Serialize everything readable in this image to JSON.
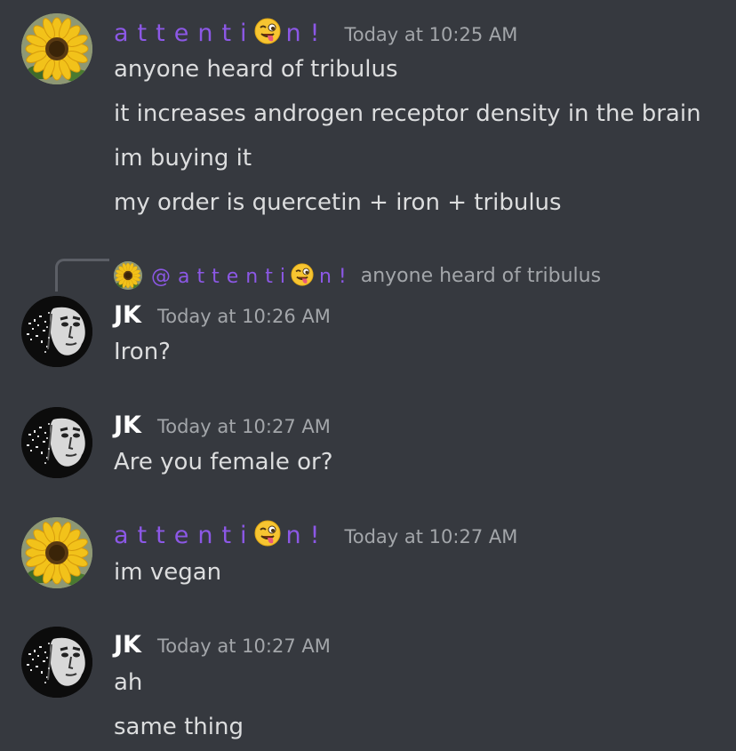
{
  "channel": {
    "messages": [
      {
        "author": "attention!",
        "author_display": {
          "before": "attenti",
          "after": "n!"
        },
        "emoji": "winking-tongue-emoji",
        "timestamp": "Today at 10:25 AM",
        "lines": [
          "anyone heard of tribulus",
          "it increases androgen receptor density in the brain",
          "im buying it",
          "my order is quercetin + iron + tribulus"
        ]
      },
      {
        "reply_to": {
          "mention_prefix": "@",
          "author_display": {
            "before": "attenti",
            "after": "n!"
          },
          "text": "anyone heard of tribulus"
        },
        "author": "JK",
        "timestamp": "Today at 10:26 AM",
        "lines": [
          "Iron?"
        ]
      },
      {
        "author": "JK",
        "timestamp": "Today at 10:27 AM",
        "lines": [
          "Are you female or?"
        ]
      },
      {
        "author": "attention!",
        "author_display": {
          "before": "attenti",
          "after": "n!"
        },
        "emoji": "winking-tongue-emoji",
        "timestamp": "Today at 10:27 AM",
        "lines": [
          "im vegan"
        ]
      },
      {
        "author": "JK",
        "timestamp": "Today at 10:27 AM",
        "lines": [
          "ah",
          "same thing"
        ]
      }
    ]
  },
  "colors": {
    "background": "#36393f",
    "username_purple": "#8c58e6",
    "text": "#dcddde",
    "muted": "#a3a6aa"
  }
}
